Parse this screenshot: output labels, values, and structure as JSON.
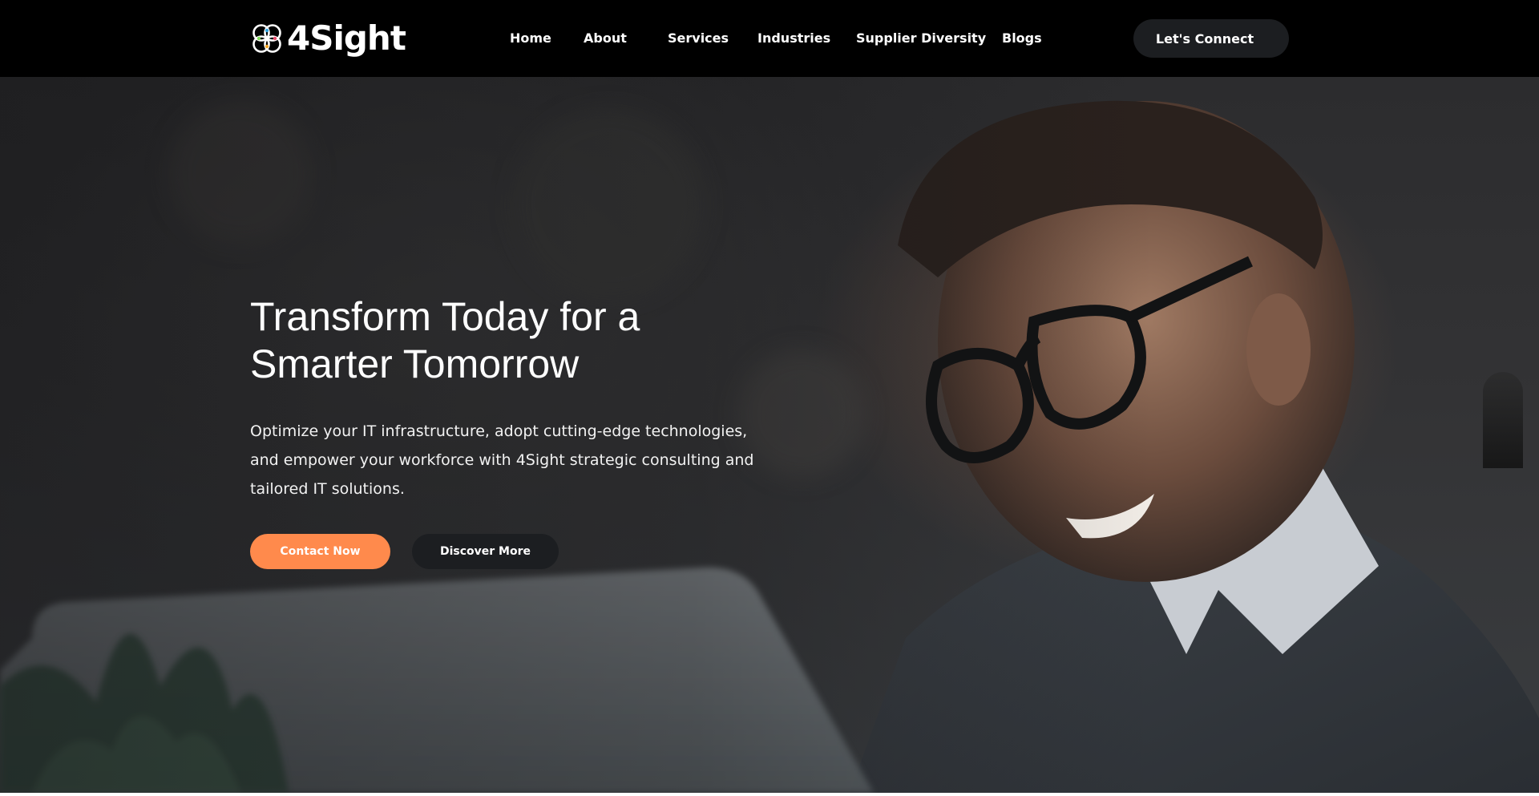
{
  "brand": {
    "name": "4Sight",
    "logo_icon": "four-ring-logo-icon",
    "logo_colors": [
      "#2fa3e0",
      "#f5a623",
      "#e94b6a",
      "#7ed957"
    ]
  },
  "nav": {
    "items": [
      {
        "label": "Home"
      },
      {
        "label": "About"
      },
      {
        "label": "Services"
      },
      {
        "label": "Industries"
      },
      {
        "label": "Supplier Diversity"
      },
      {
        "label": "Blogs"
      }
    ],
    "cta_label": "Let's Connect"
  },
  "hero": {
    "title_line1": "Transform Today for a",
    "title_line2": "Smarter Tomorrow",
    "subtitle": "Optimize your IT infrastructure, adopt cutting-edge technologies, and empower your workforce with 4Sight strategic consulting and tailored IT solutions.",
    "primary_button": "Contact Now",
    "secondary_button": "Discover More",
    "background_image": "smiling-man-with-glasses-at-laptop-photo"
  },
  "colors": {
    "header_bg": "#000000",
    "accent_orange": "#ff8a4c",
    "dark_button": "#1c1e21",
    "text_light": "#ffffff"
  }
}
